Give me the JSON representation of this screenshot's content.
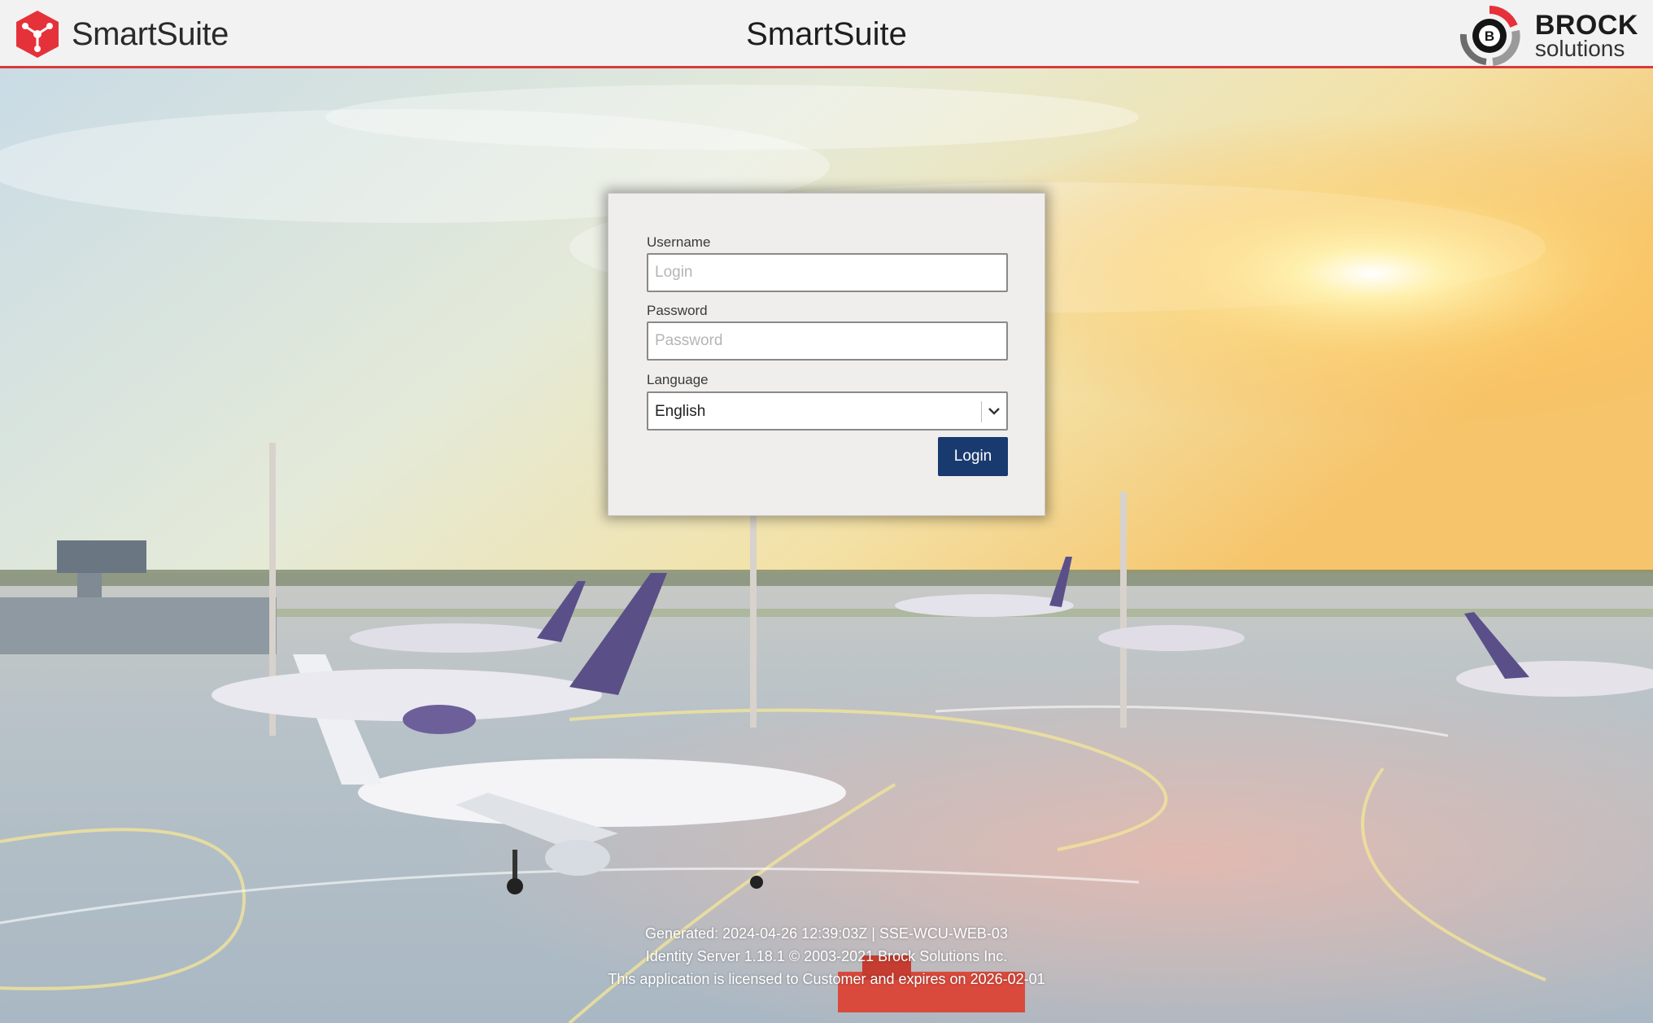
{
  "header": {
    "app_name": "SmartSuite",
    "title": "SmartSuite",
    "partner_logo": {
      "line1": "BROCK",
      "line2": "solutions",
      "badge": "B"
    },
    "icons": {
      "brand": "smartsuite-logo-icon",
      "partner": "brock-logo-icon"
    },
    "accent_color": "#d93a3a"
  },
  "login": {
    "username_label": "Username",
    "username_placeholder": "Login",
    "username_value": "",
    "password_label": "Password",
    "password_placeholder": "Password",
    "password_value": "",
    "language_label": "Language",
    "language_selected": "English",
    "submit_label": "Login",
    "button_color": "#193a6e"
  },
  "footer": {
    "generated": "Generated: 2024-04-26 12:39:03Z | SSE-WCU-WEB-03",
    "version": "Identity Server 1.18.1 © 2003-2021 Brock Solutions Inc.",
    "license": "This application is licensed to Customer and expires on 2026-02-01"
  }
}
